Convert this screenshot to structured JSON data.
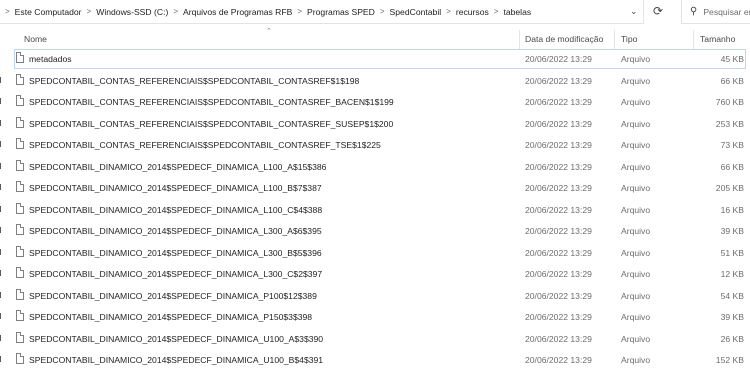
{
  "address": {
    "crumbs": [
      "Este Computador",
      "Windows-SSD (C:)",
      "Arquivos de Programas RFB",
      "Programas SPED",
      "SpedContabil",
      "recursos",
      "tabelas"
    ],
    "separator": ">",
    "dropdown_icon": "chevron-down-icon",
    "refresh_icon": "refresh-icon"
  },
  "search": {
    "placeholder": "Pesquisar em",
    "icon": "search-icon"
  },
  "columns": {
    "name": "Nome",
    "date": "Data de modificação",
    "type": "Tipo",
    "size": "Tamanho"
  },
  "files": [
    {
      "name": "metadados",
      "date": "20/06/2022 13:29",
      "type": "Arquivo",
      "size": "45 KB"
    },
    {
      "name": "SPEDCONTABIL_CONTAS_REFERENCIAIS$SPEDCONTABIL_CONTASREF$1$198",
      "date": "20/06/2022 13:29",
      "type": "Arquivo",
      "size": "66 KB"
    },
    {
      "name": "SPEDCONTABIL_CONTAS_REFERENCIAIS$SPEDCONTABIL_CONTASREF_BACEN$1$199",
      "date": "20/06/2022 13:29",
      "type": "Arquivo",
      "size": "760 KB"
    },
    {
      "name": "SPEDCONTABIL_CONTAS_REFERENCIAIS$SPEDCONTABIL_CONTASREF_SUSEP$1$200",
      "date": "20/06/2022 13:29",
      "type": "Arquivo",
      "size": "253 KB"
    },
    {
      "name": "SPEDCONTABIL_CONTAS_REFERENCIAIS$SPEDCONTABIL_CONTASREF_TSE$1$225",
      "date": "20/06/2022 13:29",
      "type": "Arquivo",
      "size": "73 KB"
    },
    {
      "name": "SPEDCONTABIL_DINAMICO_2014$SPEDECF_DINAMICA_L100_A$15$386",
      "date": "20/06/2022 13:29",
      "type": "Arquivo",
      "size": "66 KB"
    },
    {
      "name": "SPEDCONTABIL_DINAMICO_2014$SPEDECF_DINAMICA_L100_B$7$387",
      "date": "20/06/2022 13:29",
      "type": "Arquivo",
      "size": "205 KB"
    },
    {
      "name": "SPEDCONTABIL_DINAMICO_2014$SPEDECF_DINAMICA_L100_C$4$388",
      "date": "20/06/2022 13:29",
      "type": "Arquivo",
      "size": "16 KB"
    },
    {
      "name": "SPEDCONTABIL_DINAMICO_2014$SPEDECF_DINAMICA_L300_A$6$395",
      "date": "20/06/2022 13:29",
      "type": "Arquivo",
      "size": "39 KB"
    },
    {
      "name": "SPEDCONTABIL_DINAMICO_2014$SPEDECF_DINAMICA_L300_B$5$396",
      "date": "20/06/2022 13:29",
      "type": "Arquivo",
      "size": "51 KB"
    },
    {
      "name": "SPEDCONTABIL_DINAMICO_2014$SPEDECF_DINAMICA_L300_C$2$397",
      "date": "20/06/2022 13:29",
      "type": "Arquivo",
      "size": "12 KB"
    },
    {
      "name": "SPEDCONTABIL_DINAMICO_2014$SPEDECF_DINAMICA_P100$12$389",
      "date": "20/06/2022 13:29",
      "type": "Arquivo",
      "size": "54 KB"
    },
    {
      "name": "SPEDCONTABIL_DINAMICO_2014$SPEDECF_DINAMICA_P150$3$398",
      "date": "20/06/2022 13:29",
      "type": "Arquivo",
      "size": "39 KB"
    },
    {
      "name": "SPEDCONTABIL_DINAMICO_2014$SPEDECF_DINAMICA_U100_A$3$390",
      "date": "20/06/2022 13:29",
      "type": "Arquivo",
      "size": "26 KB"
    },
    {
      "name": "SPEDCONTABIL_DINAMICO_2014$SPEDECF_DINAMICA_U100_B$4$391",
      "date": "20/06/2022 13:29",
      "type": "Arquivo",
      "size": "152 KB"
    }
  ],
  "selected_index": 0,
  "colors": {
    "selection_border": "#c3d6ec",
    "muted_text": "#6d6d6d"
  }
}
